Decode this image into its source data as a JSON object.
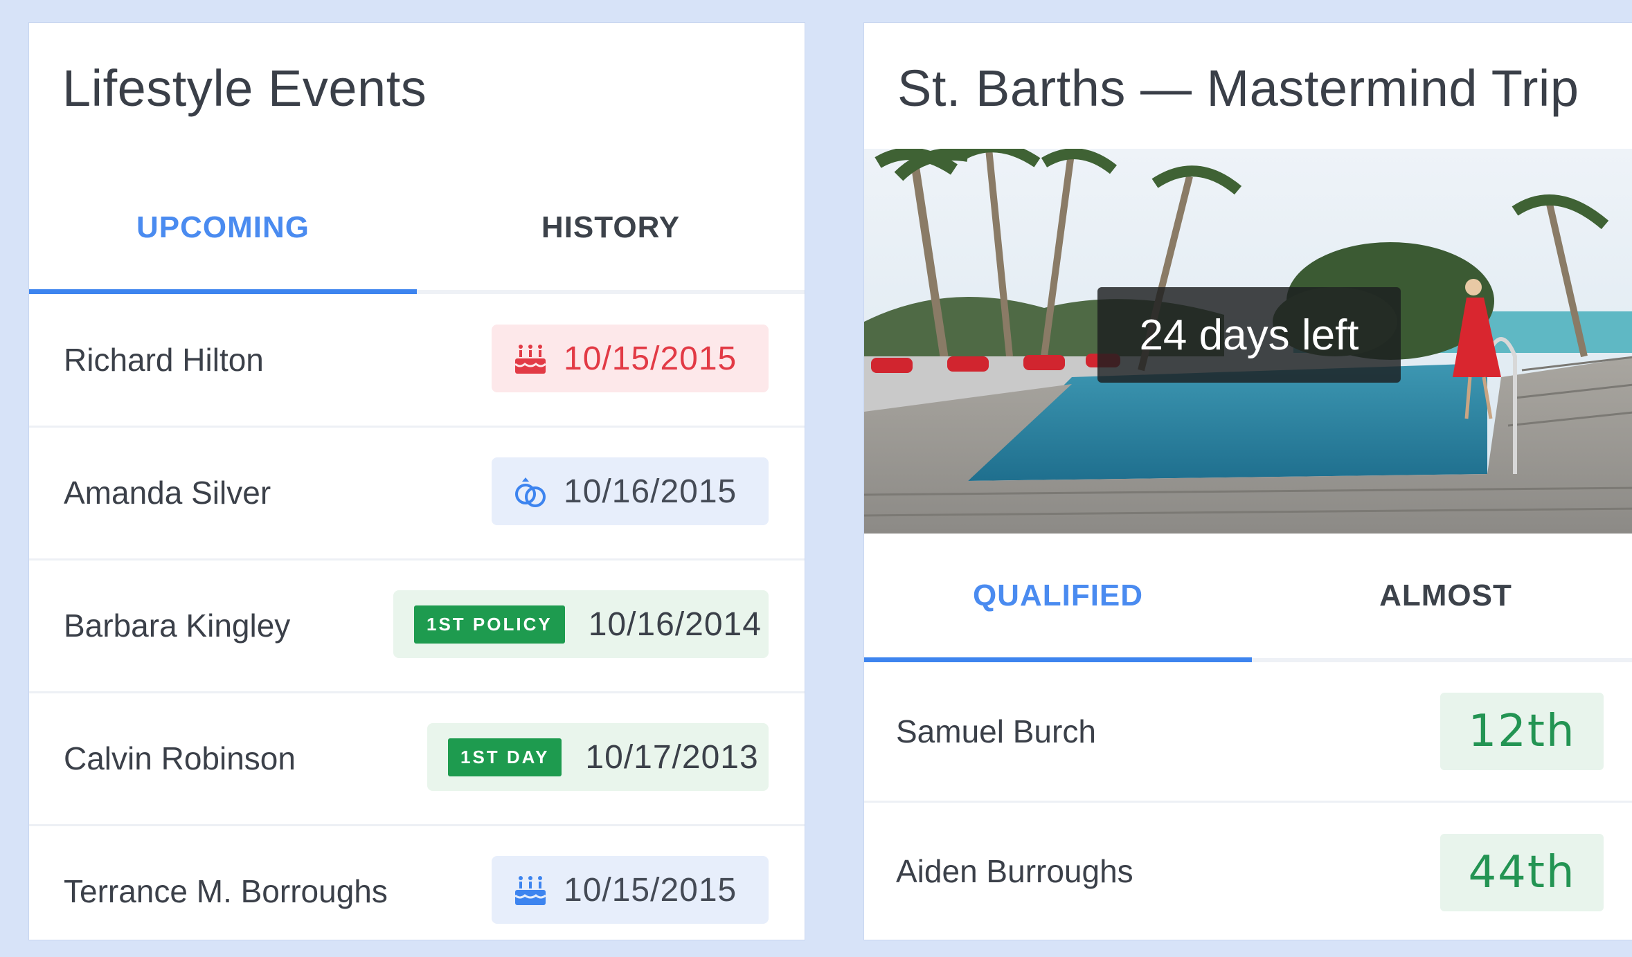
{
  "lifestyle": {
    "title": "Lifestyle Events",
    "tabs": [
      {
        "label": "UPCOMING",
        "active": true
      },
      {
        "label": "HISTORY",
        "active": false
      }
    ],
    "events": [
      {
        "name": "Richard Hilton",
        "date": "10/15/2015",
        "style": "red",
        "icon": "birthday-cake-icon"
      },
      {
        "name": "Amanda Silver",
        "date": "10/16/2015",
        "style": "blue",
        "icon": "wedding-rings-icon"
      },
      {
        "name": "Barbara Kingley",
        "date": "10/16/2014",
        "style": "green",
        "tag": "1ST POLICY"
      },
      {
        "name": "Calvin Robinson",
        "date": "10/17/2013",
        "style": "green",
        "tag": "1ST DAY"
      },
      {
        "name": "Terrance M. Borroughs",
        "date": "10/15/2015",
        "style": "blue",
        "icon": "birthday-cake-icon"
      }
    ]
  },
  "trip": {
    "title": "St. Barths — Mastermind Trip",
    "countdown": "24 days left",
    "tabs": [
      {
        "label": "QUALIFIED",
        "active": true
      },
      {
        "label": "ALMOST",
        "active": false
      }
    ],
    "ranking": [
      {
        "name": "Samuel Burch",
        "rank": "12th"
      },
      {
        "name": "Aiden Burroughs",
        "rank": "44th"
      }
    ]
  },
  "colors": {
    "accent": "#3d84ef",
    "birthday_red": "#e23a45",
    "tag_green": "#1e9b4f",
    "rank_green": "#239453"
  }
}
